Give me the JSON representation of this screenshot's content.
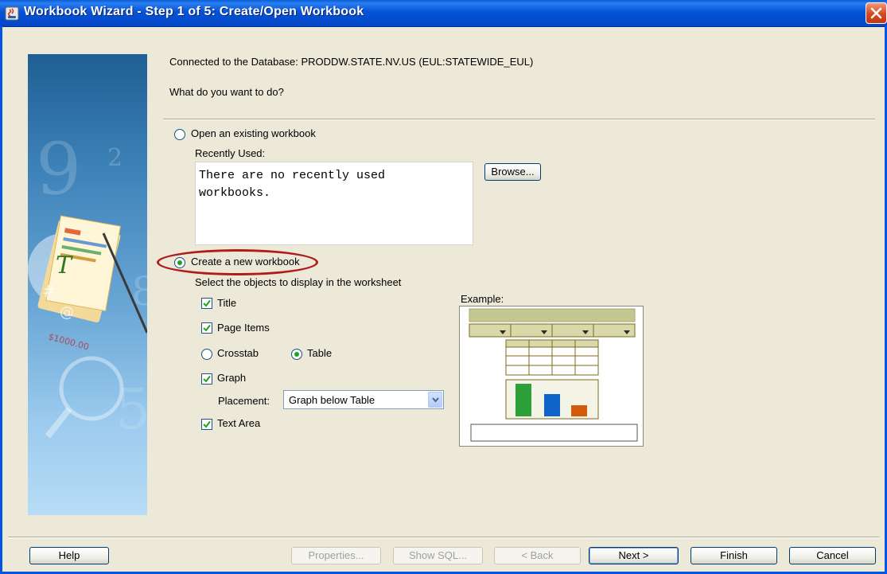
{
  "window": {
    "title": "Workbook Wizard - Step 1 of 5: Create/Open Workbook"
  },
  "header": {
    "connection": "Connected to the Database: PRODDW.STATE.NV.US (EUL:STATEWIDE_EUL)",
    "question": "What do you want to do?"
  },
  "open_existing": {
    "label": "Open an existing workbook",
    "selected": false,
    "recent_label": "Recently Used:",
    "recent_text": "There are no recently used workbooks.",
    "browse_label": "Browse..."
  },
  "create_new": {
    "label": "Create a new workbook",
    "selected": true,
    "objects_label": "Select the objects to display in the worksheet",
    "title_label": "Title",
    "title_checked": true,
    "page_items_label": "Page Items",
    "page_items_checked": true,
    "crosstab_label": "Crosstab",
    "table_label": "Table",
    "layout_selected": "Table",
    "graph_label": "Graph",
    "graph_checked": true,
    "placement_label": "Placement:",
    "placement_value": "Graph below Table",
    "text_area_label": "Text Area",
    "text_area_checked": true
  },
  "example": {
    "label": "Example:",
    "colors": {
      "olive": "#c4c78f",
      "dark_olive": "#7c6a22",
      "green": "#2ea03a",
      "blue": "#1063c8",
      "orange": "#d45a0c"
    }
  },
  "footer": {
    "help": "Help",
    "properties": "Properties...",
    "show_sql": "Show SQL...",
    "back": "< Back",
    "next": "Next >",
    "finish": "Finish",
    "cancel": "Cancel"
  },
  "colors": {
    "title_bar": "#0553d6",
    "window_bg": "#ece9d8",
    "highlight_ring": "#b01c1c"
  }
}
